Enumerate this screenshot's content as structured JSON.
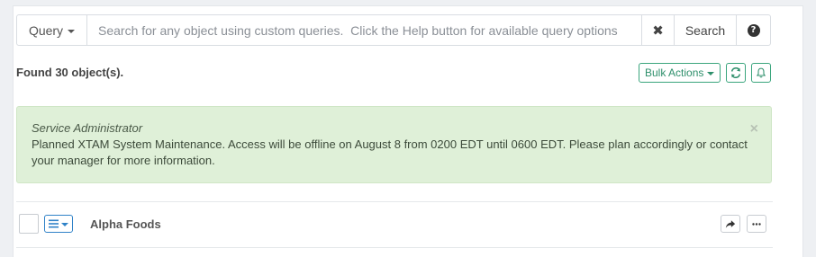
{
  "search": {
    "query_label": "Query",
    "placeholder": "Search for any object using custom queries.  Click the Help button for available query options",
    "value": "",
    "clear_glyph": "✖",
    "search_label": "Search",
    "help_glyph": "?"
  },
  "results": {
    "found_text": "Found 30 object(s).",
    "bulk_actions_label": "Bulk Actions"
  },
  "alert": {
    "title": "Service Administrator",
    "message": "Planned XTAM System Maintenance. Access will be offline on August 8 from 0200 EDT until 0600 EDT. Please plan accordingly or contact your manager for more information.",
    "close_glyph": "×"
  },
  "list": {
    "items": [
      {
        "title": "Alpha Foods"
      }
    ]
  },
  "icons": {
    "refresh": "refresh-icon",
    "bell": "bell-icon",
    "menu": "bars-icon",
    "share": "share-icon",
    "more": "ellipsis-icon"
  },
  "colors": {
    "accent_green": "#2e8f6b",
    "alert_bg": "#dff0d8",
    "accent_blue": "#2f82c8"
  }
}
